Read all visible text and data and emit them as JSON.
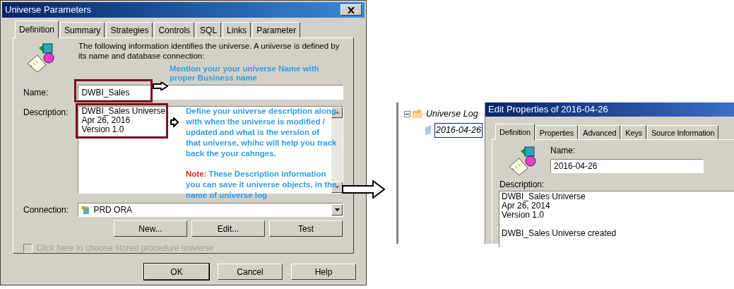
{
  "dialog": {
    "title": "Universe Parameters",
    "tabs": [
      {
        "label": "Definition",
        "selected": true
      },
      {
        "label": "Summary",
        "selected": false
      },
      {
        "label": "Strategies",
        "selected": false
      },
      {
        "label": "Controls",
        "selected": false
      },
      {
        "label": "SQL",
        "selected": false
      },
      {
        "label": "Links",
        "selected": false
      },
      {
        "label": "Parameter",
        "selected": false
      }
    ],
    "intro": "The following information identifies the universe. A universe is defined by its name and database connection:",
    "name": {
      "label": "Name:",
      "value": "DWBI_Sales"
    },
    "description": {
      "label": "Description:",
      "lines": [
        "DWBI_Sales Universe",
        "Apr 26, 2016",
        "Version 1.0"
      ]
    },
    "connection": {
      "label": "Connection:",
      "value": "PRD ORA"
    },
    "connection_buttons": [
      "New...",
      "Edit...",
      "Test"
    ],
    "stored_procedure": {
      "label": "Click here to choose stored procedure universe",
      "checked": false,
      "disabled": true
    },
    "buttons": [
      {
        "label": "OK",
        "default": true
      },
      {
        "label": "Cancel",
        "default": false
      },
      {
        "label": "Help",
        "default": false
      }
    ]
  },
  "annotations": {
    "name": [
      "Mention your your universe Name with",
      "proper Business name"
    ],
    "description": [
      "Define your universe description along",
      "with when the universe is modified /",
      "updated and what is the version of",
      "that universe, whihc will help you track",
      "back the your cahnges."
    ],
    "note_label": "Note:",
    "note_lines": [
      "These Description information",
      "you can save it universe objects, in the",
      "name of universe log"
    ]
  },
  "tree": {
    "items": [
      {
        "label": "Universe Log",
        "expanded": true,
        "children": [
          {
            "label": "2016-04-26",
            "selected": true
          }
        ]
      }
    ]
  },
  "edit_dialog": {
    "title": "Edit Properties of 2016-04-26",
    "tabs": [
      {
        "label": "Definition",
        "selected": true
      },
      {
        "label": "Properties",
        "selected": false
      },
      {
        "label": "Advanced",
        "selected": false
      },
      {
        "label": "Keys",
        "selected": false
      },
      {
        "label": "Source Information",
        "selected": false
      }
    ],
    "name": {
      "label": "Name:",
      "value": "2016-04-26"
    },
    "description": {
      "label": "Description:",
      "paragraphs": [
        [
          "DWBI_Sales Universe",
          "Apr 26, 2014",
          "Version 1.0"
        ],
        [
          "DWBI_Sales Universe created"
        ]
      ]
    }
  }
}
